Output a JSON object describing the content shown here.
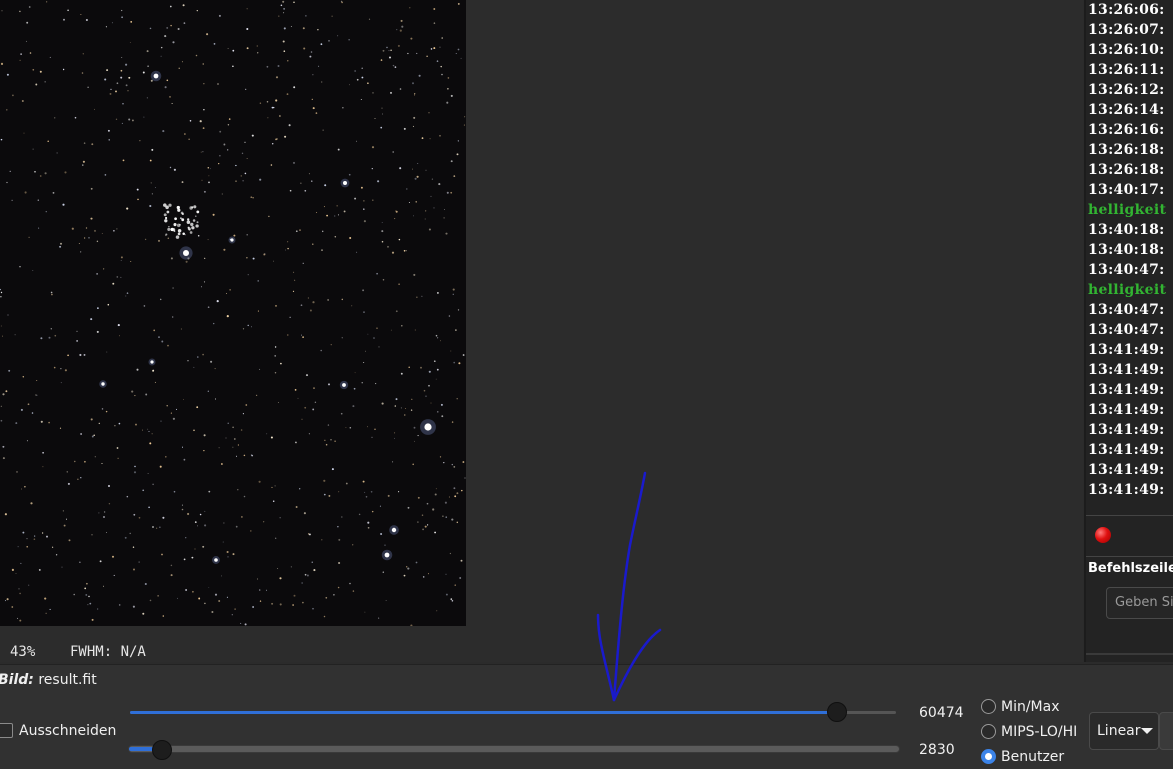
{
  "viewer": {
    "zoom": "43%",
    "fwhm": "FWHM: N/A"
  },
  "log": {
    "lines": [
      {
        "text": "13:26:06:",
        "color": "white"
      },
      {
        "text": "13:26:07:",
        "color": "white"
      },
      {
        "text": "13:26:10:",
        "color": "white"
      },
      {
        "text": "13:26:11:",
        "color": "white"
      },
      {
        "text": "13:26:12:",
        "color": "white"
      },
      {
        "text": "13:26:14:",
        "color": "white"
      },
      {
        "text": "13:26:16:",
        "color": "white"
      },
      {
        "text": "13:26:18:",
        "color": "white"
      },
      {
        "text": "13:26:18:",
        "color": "white"
      },
      {
        "text": "13:40:17:",
        "color": "white"
      },
      {
        "text": "helligkeit",
        "color": "green"
      },
      {
        "text": "13:40:18:",
        "color": "white"
      },
      {
        "text": "13:40:18:",
        "color": "white"
      },
      {
        "text": "13:40:47:",
        "color": "white"
      },
      {
        "text": "helligkeit",
        "color": "green"
      },
      {
        "text": "13:40:47:",
        "color": "white"
      },
      {
        "text": "13:40:47:",
        "color": "white"
      },
      {
        "text": "13:41:49:",
        "color": "white"
      },
      {
        "text": "13:41:49:",
        "color": "white"
      },
      {
        "text": "13:41:49:",
        "color": "white"
      },
      {
        "text": "13:41:49:",
        "color": "white"
      },
      {
        "text": "13:41:49:",
        "color": "white"
      },
      {
        "text": "13:41:49:",
        "color": "white"
      },
      {
        "text": "13:41:49:",
        "color": "white"
      },
      {
        "text": "13:41:49:",
        "color": "white"
      }
    ],
    "command_label": "Befehlszeile",
    "command_placeholder": "Geben Si"
  },
  "bottom": {
    "image_label_prefix": "Bild:",
    "image_filename": "result.fit",
    "crop_label": "Ausschneiden",
    "hi_slider": {
      "value": "60474",
      "max": 65535
    },
    "lo_slider": {
      "value": "2830",
      "max": 65535
    },
    "mode_options": [
      {
        "label": "Min/Max",
        "checked": false
      },
      {
        "label": "MIPS-LO/HI",
        "checked": false
      },
      {
        "label": "Benutzer",
        "checked": true
      }
    ],
    "scale_selected": "Linear"
  },
  "colors": {
    "accent": "#2f6fd8",
    "log_green": "#32b432",
    "annotation": "#1a1acc"
  }
}
